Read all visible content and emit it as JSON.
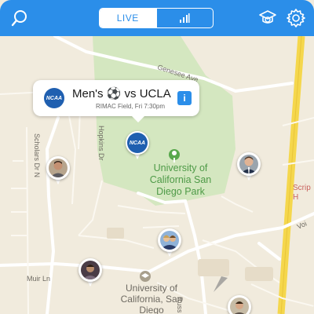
{
  "topbar": {
    "search_icon": "search-icon",
    "tabs": [
      {
        "label": "LIVE",
        "active": true
      },
      {
        "label": "",
        "icon": "bar-chart-icon",
        "active": false
      }
    ],
    "profile_icon": "graduation-cap-icon",
    "settings_icon": "gear-icon",
    "bar_color": "#2b8ee9"
  },
  "map": {
    "roads": {
      "genesee": "Genesee Ave",
      "scholars": "Scholars Dr N",
      "hopkins": "Hopkins Dr",
      "muir": "Muir Ln",
      "russell": "Russ",
      "voigt": "Voi"
    },
    "park_label": "University of California San Diego Park",
    "campus_label": "University of California, San Diego",
    "right_edge_label": "Scrip H"
  },
  "event_callout": {
    "logo_text": "NCAA",
    "title": "Men's ⚽ vs UCLA",
    "subtitle": "RIMAC Field, Fri 7:30pm",
    "info_label": "i"
  },
  "pins": {
    "ncaa_pin_text": "NCAA"
  }
}
